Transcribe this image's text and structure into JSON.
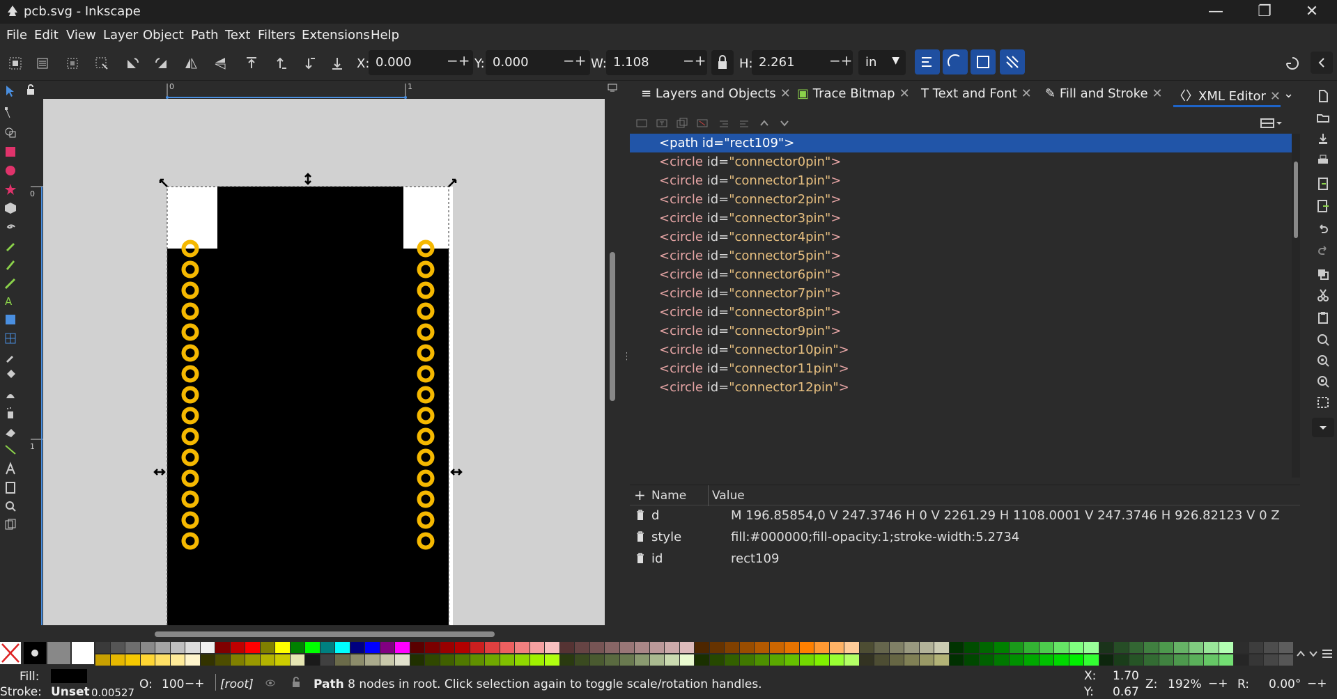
{
  "window": {
    "title": "pcb.svg - Inkscape",
    "minimize_icon": "minimize-icon",
    "restore_icon": "restore-icon",
    "close_icon": "close-icon"
  },
  "menu": [
    "File",
    "Edit",
    "View",
    "Layer",
    "Object",
    "Path",
    "Text",
    "Filters",
    "Extensions",
    "Help"
  ],
  "toolbar": {
    "x_label": "X:",
    "x_value": "0.000",
    "y_label": "Y:",
    "y_value": "0.000",
    "w_label": "W:",
    "w_value": "1.108",
    "h_label": "H:",
    "h_value": "2.261",
    "unit": "in"
  },
  "rulers": {
    "h_ticks": [
      "0",
      "1"
    ],
    "v_ticks": [
      "0",
      "1"
    ]
  },
  "tabs": [
    {
      "label": "Layers and Objects",
      "icon": "layers-icon"
    },
    {
      "label": "Trace Bitmap",
      "icon": "trace-bitmap-icon"
    },
    {
      "label": "Text and Font",
      "icon": "text-font-icon"
    },
    {
      "label": "Fill and Stroke",
      "icon": "fill-stroke-icon"
    },
    {
      "label": "XML Editor",
      "icon": "xml-editor-icon"
    }
  ],
  "xml_nodes": [
    {
      "tag": "path",
      "id": "rect109"
    },
    {
      "tag": "circle",
      "id": "connector0pin"
    },
    {
      "tag": "circle",
      "id": "connector1pin"
    },
    {
      "tag": "circle",
      "id": "connector2pin"
    },
    {
      "tag": "circle",
      "id": "connector3pin"
    },
    {
      "tag": "circle",
      "id": "connector4pin"
    },
    {
      "tag": "circle",
      "id": "connector5pin"
    },
    {
      "tag": "circle",
      "id": "connector6pin"
    },
    {
      "tag": "circle",
      "id": "connector7pin"
    },
    {
      "tag": "circle",
      "id": "connector8pin"
    },
    {
      "tag": "circle",
      "id": "connector9pin"
    },
    {
      "tag": "circle",
      "id": "connector10pin"
    },
    {
      "tag": "circle",
      "id": "connector11pin"
    },
    {
      "tag": "circle",
      "id": "connector12pin"
    }
  ],
  "attributes": {
    "add_label": "+",
    "col_name": "Name",
    "col_value": "Value",
    "rows": [
      {
        "name": "d",
        "value": "M 196.85854,0 V 247.3746 H 0 V 2261.29 H 1108.0001 V 247.3746 H 926.82123 V 0 Z"
      },
      {
        "name": "style",
        "value": "fill:#000000;fill-opacity:1;stroke-width:5.2734"
      },
      {
        "name": "id",
        "value": "rect109"
      }
    ]
  },
  "status": {
    "fill_label": "Fill:",
    "stroke_label": "Stroke:",
    "stroke_value": "Unset",
    "stroke_width": "0.00527",
    "opacity_label": "O:",
    "opacity_value": "100",
    "layer": "[root]",
    "message_bold": "Path",
    "message": " 8 nodes in root. Click selection again to toggle scale/rotation handles.",
    "x_label": "X:",
    "x_value": "1.70",
    "y_label": "Y:",
    "y_value": "0.67",
    "zoom_label": "Z:",
    "zoom_value": "192%",
    "rotate_label": "R:",
    "rotate_value": "0.00°"
  },
  "colors": {
    "pcb_body": "#000000",
    "pad_ring": "#f5b800",
    "selected_row": "#2155a8",
    "active_tab": "#1e64c8"
  }
}
